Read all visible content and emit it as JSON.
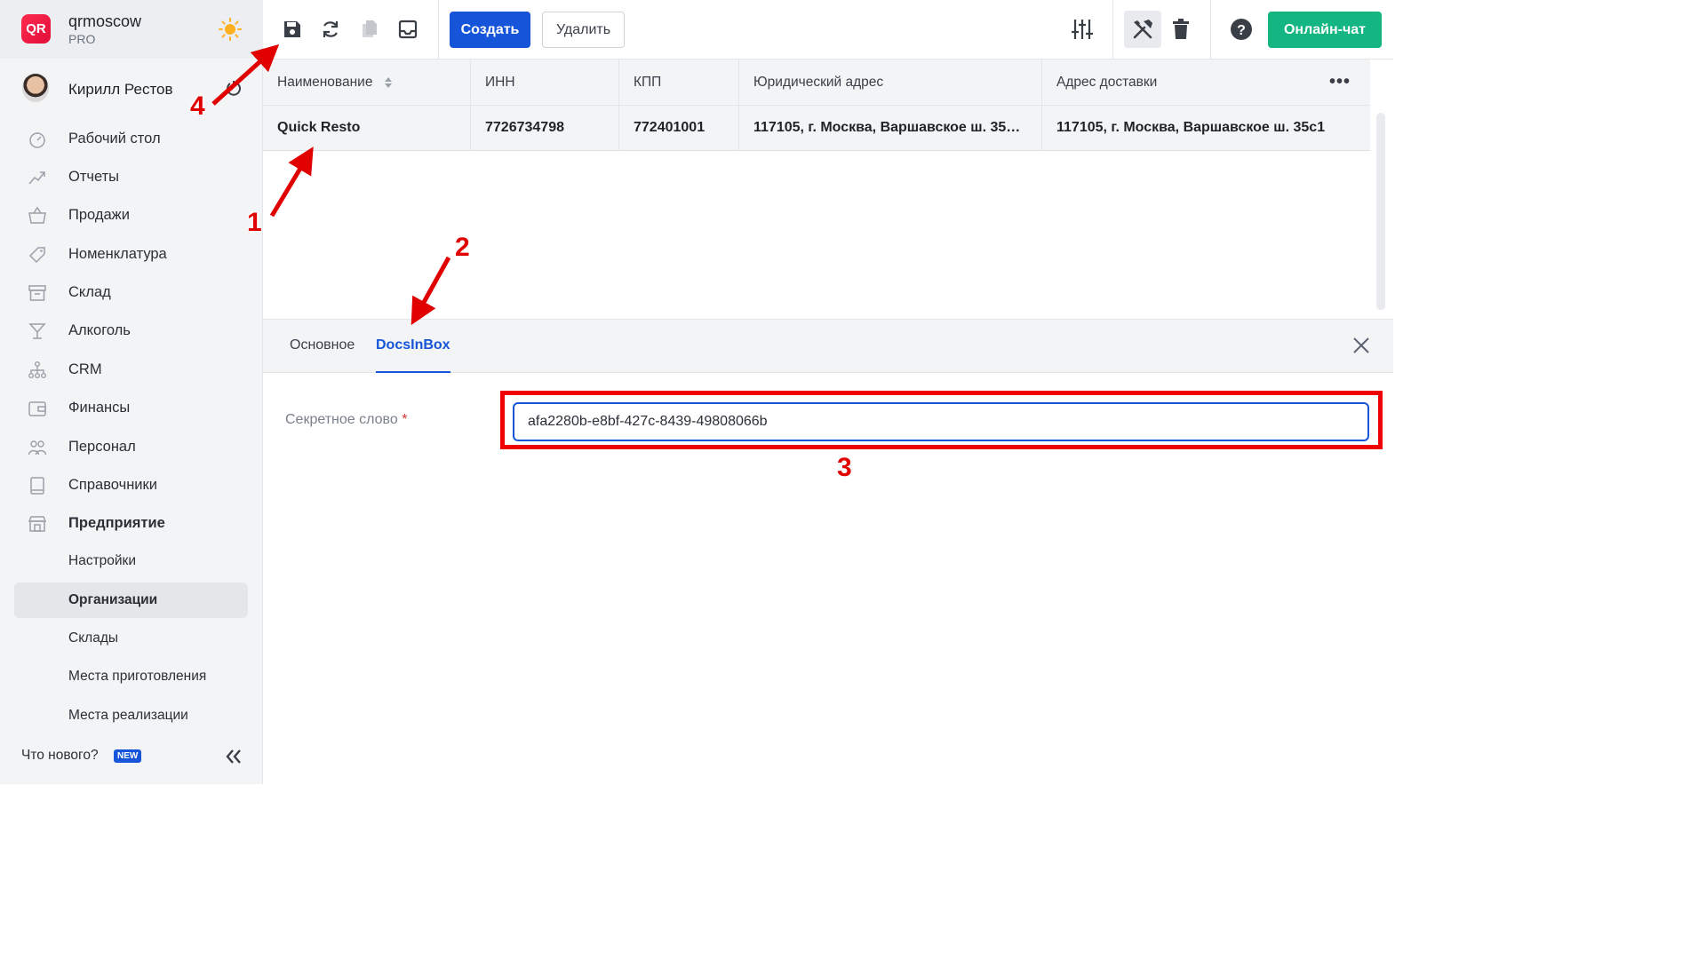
{
  "sidebar": {
    "brand": {
      "name": "qrmoscow",
      "plan": "PRO",
      "logo_text": "QR"
    },
    "user": {
      "name": "Кирилл Рестов"
    },
    "items": [
      {
        "label": "Рабочий стол",
        "icon": "dashboard-icon"
      },
      {
        "label": "Отчеты",
        "icon": "chart-icon"
      },
      {
        "label": "Продажи",
        "icon": "basket-icon"
      },
      {
        "label": "Номенклатура",
        "icon": "tag-icon"
      },
      {
        "label": "Склад",
        "icon": "archive-icon"
      },
      {
        "label": "Алкоголь",
        "icon": "glass-icon"
      },
      {
        "label": "CRM",
        "icon": "people-tree-icon"
      },
      {
        "label": "Финансы",
        "icon": "wallet-icon"
      },
      {
        "label": "Персонал",
        "icon": "staff-icon"
      },
      {
        "label": "Справочники",
        "icon": "book-icon"
      },
      {
        "label": "Предприятие",
        "icon": "store-icon"
      }
    ],
    "subitems": [
      {
        "label": "Настройки"
      },
      {
        "label": "Организации"
      },
      {
        "label": "Склады"
      },
      {
        "label": "Места приготовления"
      },
      {
        "label": "Места реализации"
      }
    ],
    "whats_new": "Что нового?",
    "new_badge": "NEW"
  },
  "toolbar": {
    "create_label": "Создать",
    "delete_label": "Удалить",
    "chat_label": "Онлайн-чат"
  },
  "table": {
    "columns": [
      "Наименование",
      "ИНН",
      "КПП",
      "Юридический адрес",
      "Адрес доставки"
    ],
    "rows": [
      [
        "Quick Resto",
        "7726734798",
        "772401001",
        "117105, г. Москва, Варшавское ш. 35…",
        "117105, г. Москва, Варшавское ш. 35с1"
      ]
    ]
  },
  "detail": {
    "tabs": [
      "Основное",
      "DocsInBox"
    ],
    "active_tab": "DocsInBox",
    "field_label": "Секретное слово",
    "required_mark": "*",
    "field_value": "afa2280b-e8bf-427c-8439-49808066b"
  },
  "annotations": [
    "1",
    "2",
    "3",
    "4"
  ],
  "colors": {
    "accent": "#1655d9",
    "chat": "#13b581",
    "annotation": "#ee0000",
    "sidebar_bg": "#f3f4f6"
  }
}
